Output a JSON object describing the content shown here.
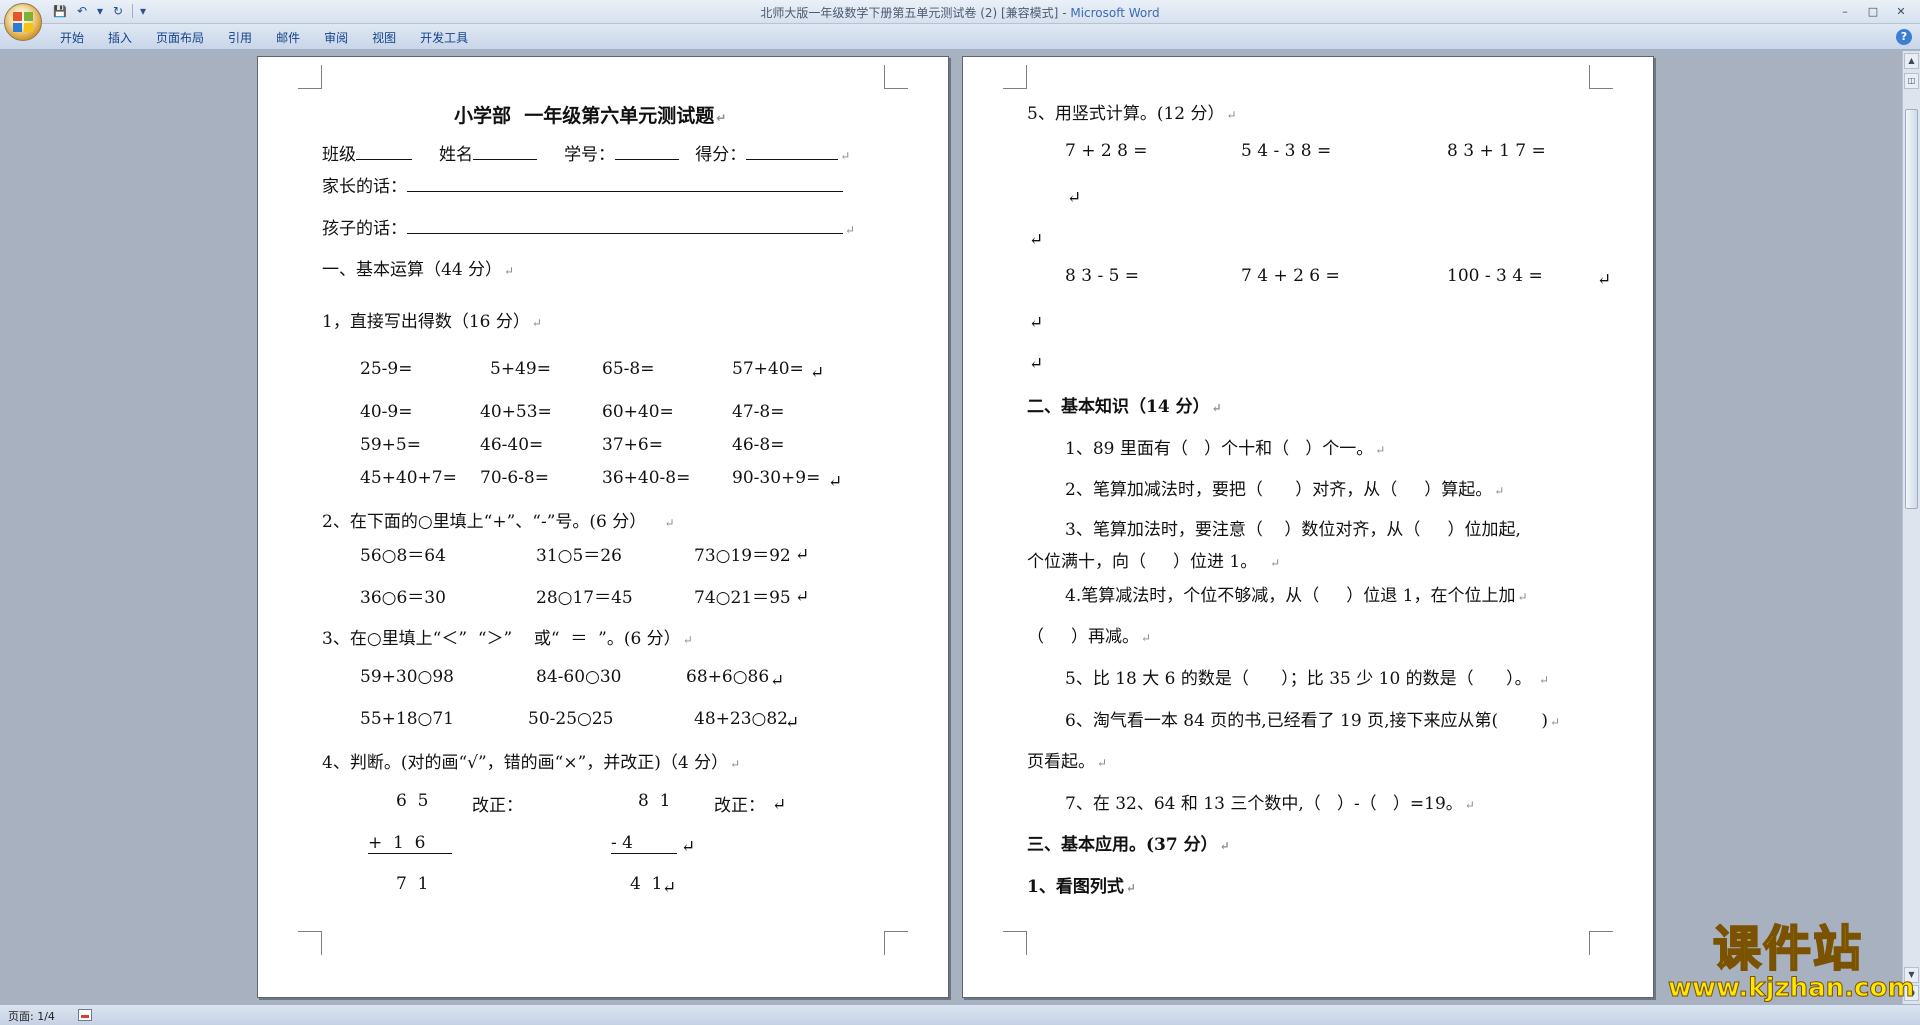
{
  "window": {
    "title": "北师大版一年级数学下册第五单元测试卷 (2) [兼容模式]",
    "app": "Microsoft Word",
    "title_sep": " - ",
    "controls": [
      "–",
      "□",
      "✕"
    ]
  },
  "qat": {
    "save": "💾",
    "undo": "↶",
    "redo": "↻",
    "dropdown": "▾"
  },
  "ribbon": {
    "tabs": [
      "开始",
      "插入",
      "页面布局",
      "引用",
      "邮件",
      "审阅",
      "视图",
      "开发工具"
    ],
    "help": "?"
  },
  "left_page": {
    "title": "小学部  一年级第六单元测试题",
    "info": {
      "class": "班级",
      "name": "姓名",
      "id": "学号：",
      "score": "得分："
    },
    "parent": "家长的话：",
    "child": "孩子的话：",
    "s1": "一、基本运算（44 分）",
    "q1": "1，直接写出得数（16 分）",
    "q1_rows": [
      [
        "25-9=",
        "5+49=",
        "65-8=",
        "57+40="
      ],
      [
        "40-9=",
        "40+53=",
        "60+40=",
        "47-8="
      ],
      [
        "59+5=",
        "46-40=",
        "37+6=",
        "46-8="
      ],
      [
        "45+40+7=",
        "70-6-8=",
        "36+40-8=",
        "90-30+9="
      ]
    ],
    "q2": "2、在下面的○里填上“+”、“-”号。(6 分）",
    "q2_rows": [
      [
        "56○8＝64",
        "31○5＝26",
        "73○19＝92"
      ],
      [
        "36○6＝30",
        "28○17＝45",
        "74○21＝95"
      ]
    ],
    "q3": "3、在○里填上“＜”  “＞”    或“  ＝  ”。(6 分）",
    "q3_rows": [
      [
        "59+30○98",
        "84-60○30",
        "68+6○86"
      ],
      [
        "55+18○71",
        "50-25○25",
        "48+23○82"
      ]
    ],
    "q4": "4、判断。(对的画“√”，错的画“×”，并改正)（4 分）",
    "q4_a": {
      "top": "6  5",
      "mid": "+  1  6",
      "bottom": "7  1"
    },
    "q4_b": {
      "top": "8  1",
      "mid": "- 4",
      "bottom": "4  1"
    },
    "fix": "改正："
  },
  "right_page": {
    "q5": "5、用竖式计算。(12 分）",
    "q5_row1": [
      "7 + 2 8 =",
      "5 4 - 3 8 =",
      "8 3 + 1 7 ="
    ],
    "q5_row2": [
      "8 3 - 5 =",
      "7 4 + 2 6 =",
      "100 - 3 4 ="
    ],
    "s2": "二、基本知识（14 分）",
    "k1": "1、89 里面有（   ）个十和（   ）个一。",
    "k2": "2、笔算加减法时，要把（      ）对齐，从（     ）算起。",
    "k3a": "3、笔算加法时，要注意（    ）数位对齐，从（     ）位加起,",
    "k3b": "个位满十，向（     ）位进 1。",
    "k4a": "4.笔算减法时，个位不够减，从（     ）位退 1，在个位上加",
    "k4b": "（     ）再减。",
    "k5": "5、比 18 大 6 的数是（      ）；比 35 少 10 的数是（      ）。",
    "k6a": "6、淘气看一本 84 页的书,已经看了 19 页,接下来应从第(        )",
    "k6b": "页看起。",
    "k7": "7、在 32、64 和 13 三个数中,（   ）-（   ）=19。",
    "s3": "三、基本应用。(37 分）",
    "a1": "1、看图列式"
  },
  "status": {
    "page": "页面: 1/4"
  },
  "watermark": {
    "cn": "课件站",
    "url": "www.kjzhan.com"
  },
  "mark": "↵"
}
